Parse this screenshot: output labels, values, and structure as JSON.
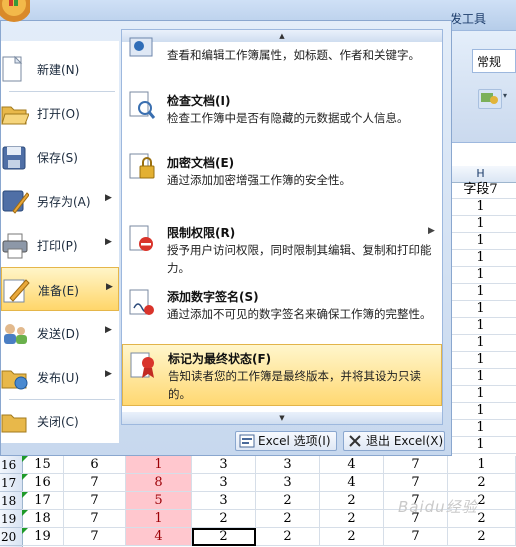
{
  "ribbon": {
    "tab_label": "发工具",
    "number_format": "常规"
  },
  "sheet": {
    "column_header": "H",
    "h_column": [
      "字段7",
      "1",
      "1",
      "1",
      "1",
      "1",
      "1",
      "1",
      "1",
      "1",
      "1",
      "1",
      "1",
      "1",
      "1",
      "1"
    ],
    "rows": [
      {
        "num": "16",
        "cells": [
          "15",
          "6",
          "1",
          "3",
          "3",
          "4",
          "7",
          "1"
        ]
      },
      {
        "num": "17",
        "cells": [
          "16",
          "7",
          "8",
          "3",
          "3",
          "4",
          "7",
          "2"
        ]
      },
      {
        "num": "18",
        "cells": [
          "17",
          "7",
          "5",
          "3",
          "2",
          "2",
          "7",
          "2"
        ]
      },
      {
        "num": "19",
        "cells": [
          "18",
          "7",
          "1",
          "2",
          "2",
          "2",
          "7",
          "2"
        ]
      },
      {
        "num": "20",
        "cells": [
          "19",
          "7",
          "4",
          "2",
          "2",
          "2",
          "7",
          "2"
        ]
      }
    ],
    "watermark": "Baidu经验"
  },
  "menu": {
    "left_items": [
      {
        "label": "新建(N)",
        "icon": "new-document-icon",
        "submenu": false
      },
      {
        "label": "打开(O)",
        "icon": "open-folder-icon",
        "submenu": false
      },
      {
        "label": "保存(S)",
        "icon": "save-disk-icon",
        "submenu": false
      },
      {
        "label": "另存为(A)",
        "icon": "save-as-icon",
        "submenu": true
      },
      {
        "label": "打印(P)",
        "icon": "printer-icon",
        "submenu": true
      },
      {
        "label": "准备(E)",
        "icon": "prepare-pencil-icon",
        "submenu": true,
        "active": true
      },
      {
        "label": "发送(D)",
        "icon": "send-people-icon",
        "submenu": true
      },
      {
        "label": "发布(U)",
        "icon": "publish-folder-icon",
        "submenu": true
      },
      {
        "label": "关闭(C)",
        "icon": "close-folder-icon",
        "submenu": false
      }
    ],
    "prepare_items": [
      {
        "title": "",
        "desc": "查看和编辑工作簿属性，如标题、作者和关键字。",
        "icon": "properties-icon"
      },
      {
        "title": "检查文档(I)",
        "desc": "检查工作簿中是否有隐藏的元数据或个人信息。",
        "icon": "inspect-document-icon"
      },
      {
        "title": "加密文档(E)",
        "desc": "通过添加加密增强工作簿的安全性。",
        "icon": "encrypt-lock-icon"
      },
      {
        "title": "限制权限(R)",
        "desc": "授予用户访问权限，同时限制其编辑、复制和打印能力。",
        "icon": "restrict-permission-icon",
        "submenu": true
      },
      {
        "title": "添加数字签名(S)",
        "desc": "通过添加不可见的数字签名来确保工作簿的完整性。",
        "icon": "digital-signature-icon"
      },
      {
        "title": "标记为最终状态(F)",
        "desc": "告知读者您的工作簿是最终版本，并将其设为只读的。",
        "icon": "mark-final-icon",
        "highlighted": true
      }
    ],
    "excel_options": "Excel 选项(I)",
    "exit_excel": "退出 Excel(X)"
  },
  "colors": {
    "menu_bg": "#dce7f5",
    "highlight": "#ffd66a",
    "pink_cell": "#ffc7ce",
    "pink_text": "#9c0006"
  }
}
